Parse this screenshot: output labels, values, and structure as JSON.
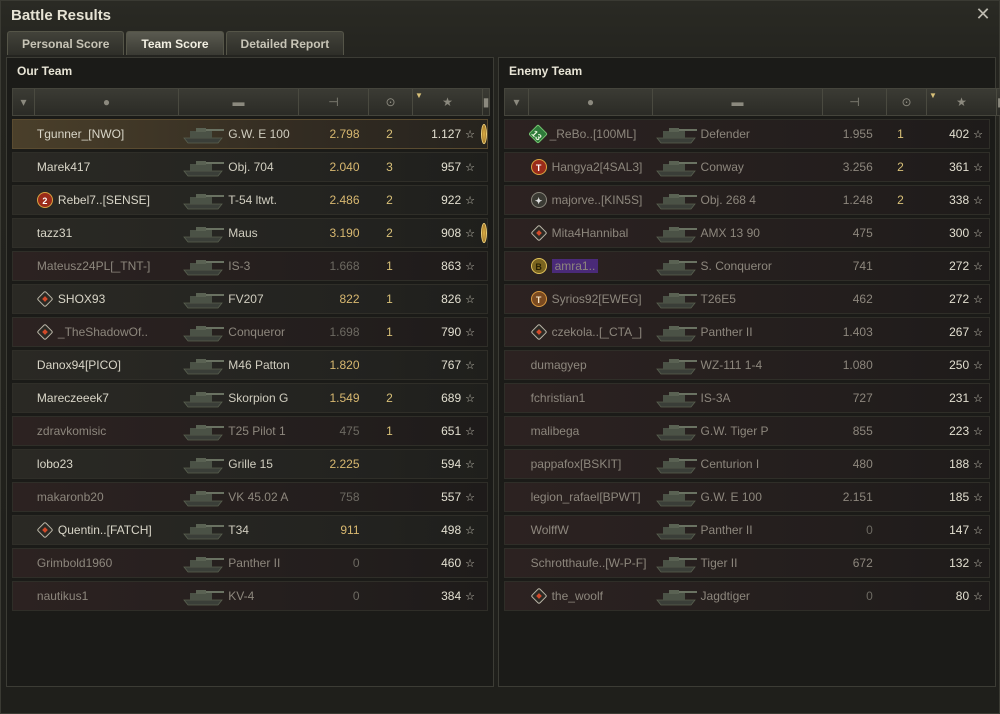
{
  "window": {
    "title": "Battle Results"
  },
  "tabs": [
    {
      "label": "Personal Score",
      "active": false
    },
    {
      "label": "Team Score",
      "active": true
    },
    {
      "label": "Detailed Report",
      "active": false
    }
  ],
  "header_icons": [
    "squad-icon",
    "player-icon",
    "tank-icon",
    "damage-icon",
    "kills-icon",
    "xp-star-icon",
    "medal-icon"
  ],
  "our_team": {
    "title": "Our Team",
    "rows": [
      {
        "player": "Tgunner_[NWO]",
        "tank": "G.W. E 100",
        "damage": "2.798",
        "kills": "2",
        "xp": "1.127",
        "badge": "",
        "mark": "",
        "medal": "medal",
        "state": "highlight"
      },
      {
        "player": "Marek417",
        "tank": "Obj. 704",
        "damage": "2.040",
        "kills": "3",
        "xp": "957",
        "badge": "",
        "mark": "",
        "medal": "",
        "state": "alive"
      },
      {
        "player": "Rebel7..[SENSE]",
        "tank": "T-54 ltwt.",
        "damage": "2.486",
        "kills": "2",
        "xp": "922",
        "badge": "",
        "mark": "red",
        "mark_text": "2",
        "medal": "",
        "state": "alive"
      },
      {
        "player": "tazz31",
        "tank": "Maus",
        "damage": "3.190",
        "kills": "2",
        "xp": "908",
        "badge": "",
        "mark": "",
        "medal": "medal",
        "state": "alive"
      },
      {
        "player": "Mateusz24PL[_TNT-]",
        "tank": "IS-3",
        "damage": "1.668",
        "kills": "1",
        "xp": "863",
        "badge": "",
        "mark": "",
        "medal": "",
        "state": "dead"
      },
      {
        "player": "SHOX93",
        "tank": "FV207",
        "damage": "822",
        "kills": "1",
        "xp": "826",
        "badge": "",
        "mark": "diamond",
        "medal": "",
        "state": "alive"
      },
      {
        "player": "_TheShadowOf..",
        "tank": "Conqueror",
        "damage": "1.698",
        "kills": "1",
        "xp": "790",
        "badge": "",
        "mark": "diamond",
        "medal": "",
        "state": "dead"
      },
      {
        "player": "Danox94[PICO]",
        "tank": "M46 Patton",
        "damage": "1.820",
        "kills": "",
        "xp": "767",
        "badge": "",
        "mark": "",
        "medal": "",
        "state": "alive"
      },
      {
        "player": "Mareczeeek7",
        "tank": "Skorpion G",
        "damage": "1.549",
        "kills": "2",
        "xp": "689",
        "badge": "",
        "mark": "",
        "medal": "",
        "state": "alive"
      },
      {
        "player": "zdravkomisic",
        "tank": "T25 Pilot 1",
        "damage": "475",
        "kills": "1",
        "xp": "651",
        "badge": "",
        "mark": "",
        "medal": "",
        "state": "dead"
      },
      {
        "player": "lobo23",
        "tank": "Grille 15",
        "damage": "2.225",
        "kills": "",
        "xp": "594",
        "badge": "",
        "mark": "",
        "medal": "",
        "state": "alive"
      },
      {
        "player": "makaronb20",
        "tank": "VK 45.02 A",
        "damage": "758",
        "kills": "",
        "xp": "557",
        "badge": "",
        "mark": "",
        "medal": "",
        "state": "dead"
      },
      {
        "player": "Quentin..[FATCH]",
        "tank": "T34",
        "damage": "911",
        "kills": "",
        "xp": "498",
        "badge": "",
        "mark": "diamond",
        "medal": "",
        "state": "alive"
      },
      {
        "player": "Grimbold1960",
        "tank": "Panther II",
        "damage": "0",
        "kills": "",
        "xp": "460",
        "badge": "",
        "mark": "",
        "medal": "",
        "state": "dead"
      },
      {
        "player": "nautikus1",
        "tank": "KV-4",
        "damage": "0",
        "kills": "",
        "xp": "384",
        "badge": "",
        "mark": "",
        "medal": "",
        "state": "dead"
      }
    ]
  },
  "enemy_team": {
    "title": "Enemy Team",
    "rows": [
      {
        "player": "_ReBo..[100ML]",
        "tank": "Defender",
        "damage": "1.955",
        "kills": "1",
        "xp": "402",
        "mark": "green",
        "mark_text": "13",
        "state": "dead"
      },
      {
        "player": "Hangya2[4SAL3]",
        "tank": "Conway",
        "damage": "3.256",
        "kills": "2",
        "xp": "361",
        "mark": "red",
        "mark_text": "T",
        "state": "dead"
      },
      {
        "player": "majorve..[KIN5S]",
        "tank": "Obj. 268 4",
        "damage": "1.248",
        "kills": "2",
        "xp": "338",
        "mark": "gray",
        "mark_text": "✦",
        "state": "dead"
      },
      {
        "player": "Mita4Hannibal",
        "tank": "AMX 13 90",
        "damage": "475",
        "kills": "",
        "xp": "300",
        "mark": "diamond",
        "state": "dead"
      },
      {
        "player": "amra1..",
        "tank": "S. Conqueror",
        "damage": "741",
        "kills": "",
        "xp": "272",
        "mark": "gold",
        "mark_text": "B",
        "purple": true,
        "state": "dead"
      },
      {
        "player": "Syrios92[EWEG]",
        "tank": "T26E5",
        "damage": "462",
        "kills": "",
        "xp": "272",
        "mark": "orange",
        "mark_text": "T",
        "state": "dead"
      },
      {
        "player": "czekola..[_CTA_]",
        "tank": "Panther II",
        "damage": "1.403",
        "kills": "",
        "xp": "267",
        "mark": "diamond",
        "state": "dead"
      },
      {
        "player": "dumagyep",
        "tank": "WZ-111 1-4",
        "damage": "1.080",
        "kills": "",
        "xp": "250",
        "mark": "",
        "state": "dead"
      },
      {
        "player": "fchristian1",
        "tank": "IS-3A",
        "damage": "727",
        "kills": "",
        "xp": "231",
        "mark": "",
        "state": "dead"
      },
      {
        "player": "malibega",
        "tank": "G.W. Tiger P",
        "damage": "855",
        "kills": "",
        "xp": "223",
        "mark": "",
        "state": "dead"
      },
      {
        "player": "pappafox[BSKIT]",
        "tank": "Centurion I",
        "damage": "480",
        "kills": "",
        "xp": "188",
        "mark": "",
        "state": "dead"
      },
      {
        "player": "legion_rafael[BPWT]",
        "tank": "G.W. E 100",
        "damage": "2.151",
        "kills": "",
        "xp": "185",
        "mark": "",
        "state": "dead"
      },
      {
        "player": "WolffW",
        "tank": "Panther II",
        "damage": "0",
        "kills": "",
        "xp": "147",
        "mark": "",
        "state": "dead"
      },
      {
        "player": "Schrotthaufe..[W-P-F]",
        "tank": "Tiger II",
        "damage": "672",
        "kills": "",
        "xp": "132",
        "mark": "",
        "state": "dead"
      },
      {
        "player": "the_woolf",
        "tank": "Jagdtiger",
        "damage": "0",
        "kills": "",
        "xp": "80",
        "mark": "diamond",
        "state": "dead"
      }
    ]
  }
}
